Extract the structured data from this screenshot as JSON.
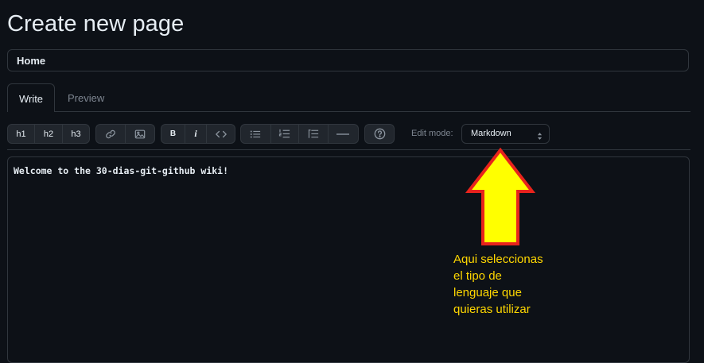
{
  "page": {
    "title": "Create new page"
  },
  "title_field": {
    "value": "Home"
  },
  "tabs": [
    {
      "label": "Write",
      "active": true
    },
    {
      "label": "Preview",
      "active": false
    }
  ],
  "toolbar": {
    "heading_buttons": [
      "h1",
      "h2",
      "h3"
    ],
    "link_icon": "link-icon",
    "image_icon": "image-icon",
    "bold_label": "B",
    "italic_label": "i",
    "code_icon": "code-icon",
    "list_icons": [
      "unordered-list-icon",
      "ordered-list-icon",
      "task-list-icon",
      "horizontal-rule-icon"
    ],
    "help_icon": "help-icon"
  },
  "edit_mode": {
    "label": "Edit mode:",
    "selected": "Markdown"
  },
  "editor": {
    "content": "Welcome to the 30-dias-git-github wiki!"
  },
  "annotation": {
    "lines": [
      "Aqui seleccionas",
      "el tipo de",
      "lenguaje que",
      "quieras utilizar"
    ],
    "arrow_color": "#ffff00",
    "arrow_outline": "#e8231c",
    "text_color": "#ffd700"
  },
  "colors": {
    "background": "#0d1117",
    "border": "#30363d",
    "button_bg": "#21262d",
    "text": "#e6edf3",
    "muted": "#7d8590"
  }
}
